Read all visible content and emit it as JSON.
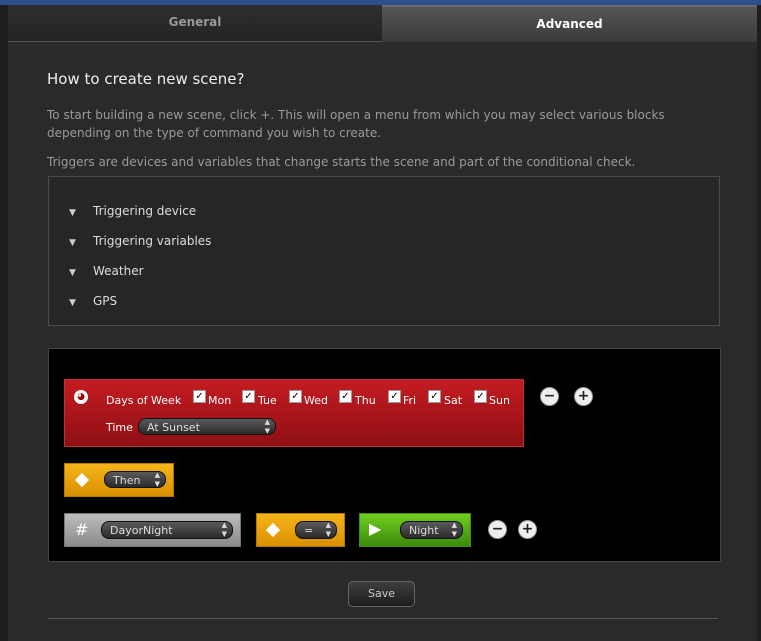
{
  "tabs": {
    "general": "General",
    "advanced": "Advanced"
  },
  "page": {
    "title": "How to create new scene?",
    "intro": "To start building a new scene, click +. This will open a menu from which you may select various blocks depending on the type of command you wish to create.",
    "triggers_note": "Triggers are devices and variables that change starts the scene and part of the conditional check."
  },
  "triggers": [
    {
      "label": "Triggering device"
    },
    {
      "label": "Triggering variables"
    },
    {
      "label": "Weather"
    },
    {
      "label": "GPS"
    }
  ],
  "scene": {
    "condition": {
      "days_label": "Days of Week",
      "days": [
        {
          "label": "Mon",
          "checked": true
        },
        {
          "label": "Tue",
          "checked": true
        },
        {
          "label": "Wed",
          "checked": true
        },
        {
          "label": "Thu",
          "checked": true
        },
        {
          "label": "Fri",
          "checked": true
        },
        {
          "label": "Sat",
          "checked": true
        },
        {
          "label": "Sun",
          "checked": true
        }
      ],
      "time_label": "Time",
      "time_value": "At Sunset",
      "icon": "clock-icon"
    },
    "then_value": "Then",
    "action": {
      "variable_symbol": "#",
      "variable_name": "DayorNight",
      "operator": "=",
      "value": "Night"
    }
  },
  "save_label": "Save",
  "colors": {
    "condition_block": "#b3151b",
    "then_block": "#f0a50f",
    "variable_block": "#a8a8a8",
    "value_block": "#5cb318",
    "top_strip": "#2d4f8a"
  }
}
